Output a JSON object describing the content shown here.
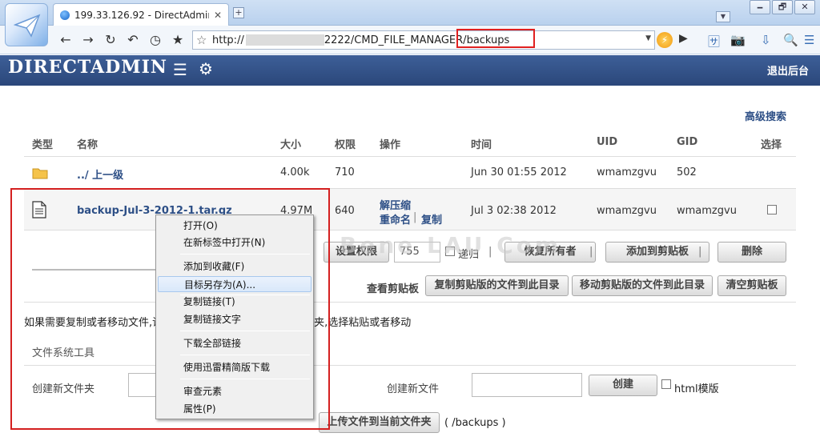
{
  "browser": {
    "tab_title": "199.33.126.92 - DirectAdmin v...",
    "tab_close": "✕",
    "new_tab": "+",
    "address": {
      "scheme": "http://",
      "rest": "2222/CMD_FILE_MANAGER/backups"
    },
    "window_buttons": [
      "🗕",
      "🗗",
      "✕"
    ]
  },
  "header": {
    "logo": "DIRECTADMIN",
    "logout": "退出后台"
  },
  "advanced_search": "高级搜索",
  "table": {
    "headers": [
      "类型",
      "名称",
      "大小",
      "权限",
      "操作",
      "时间",
      "UID",
      "GID",
      "选择"
    ],
    "rows": [
      {
        "name": "../ 上一级",
        "size": "4.00k",
        "perm": "710",
        "time": "Jun 30 01:55 2012",
        "uid": "wmamzgvu",
        "gid": "502"
      },
      {
        "name": "backup-Jul-3-2012-1.tar.gz",
        "size": "4.97M",
        "perm": "640",
        "op_extract": "解压缩",
        "op_rename": "重命名",
        "op_sep": "|",
        "op_copy": "复制",
        "time": "Jul 3 02:38 2012",
        "uid": "wmamzgvu",
        "gid": "wmamzgvu"
      }
    ]
  },
  "actions": {
    "set_perm": "设置权限",
    "perm_value": "755",
    "recursive": "递归",
    "restore_owner": "恢复所有者",
    "add_clipboard": "添加到剪贴板",
    "delete": "删除",
    "sep": "|",
    "view_clipboard": "查看剪贴板",
    "copy_here": "复制剪贴版的文件到此目录",
    "move_here": "移动剪贴版的文件到此目录",
    "clear_clipboard": "清空剪贴板"
  },
  "watermark": "Bene LAU Com",
  "notice": {
    "left": "如果需要复制或者移动文件,请先",
    "right": "夹,选择粘贴或者移动"
  },
  "fs_tools": {
    "title": "文件系统工具",
    "create_folder_label": "创建新文件夹",
    "create_file_label": "创建新文件",
    "create_button": "创建",
    "html_template": "html模版",
    "upload_button": "上传文件到当前文件夹",
    "upload_path": "( /backups )"
  },
  "context_menu": {
    "items": [
      "打开(O)",
      "在新标签中打开(N)",
      "添加到收藏(F)",
      "目标另存为(A)...",
      "复制链接(T)",
      "复制链接文字",
      "下载全部链接",
      "使用迅雷精简版下载",
      "审查元素",
      "属性(P)"
    ]
  },
  "colors": {
    "header_bg": "#2e4b80",
    "link": "#2d4f86",
    "annotation": "#d42020"
  }
}
